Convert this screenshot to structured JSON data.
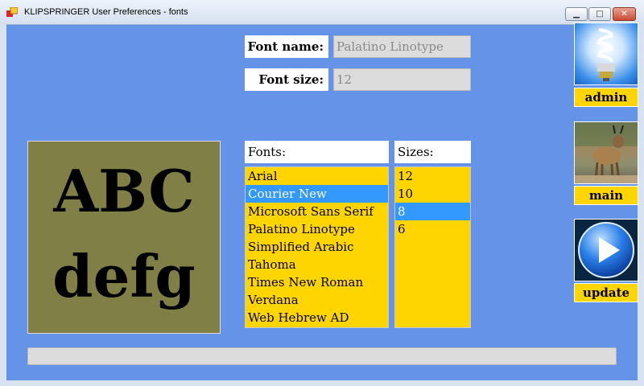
{
  "window": {
    "title": "KLIPSPRINGER User Preferences - fonts"
  },
  "font_name": {
    "label": "Font name:",
    "value": "Palatino Linotype"
  },
  "font_size": {
    "label": "Font size:",
    "value": "12"
  },
  "preview": {
    "line1": "ABC",
    "line2": "defg"
  },
  "fonts": {
    "header": "Fonts:",
    "items": [
      "Arial",
      "Courier New",
      "Microsoft Sans Serif",
      "Palatino Linotype",
      "Simplified Arabic",
      "Tahoma",
      "Times New Roman",
      "Verdana",
      "Web Hebrew AD"
    ],
    "selected": "Courier New"
  },
  "sizes": {
    "header": "Sizes:",
    "items": [
      "12",
      "10",
      "8",
      "6"
    ],
    "selected": "8"
  },
  "side_buttons": [
    {
      "label": "admin",
      "icon": "lightbulb-icon"
    },
    {
      "label": "main",
      "icon": "antelope-photo-icon"
    },
    {
      "label": "update",
      "icon": "play-icon"
    }
  ],
  "progress": {
    "fraction": 0
  },
  "colors": {
    "background": "#6593e8",
    "list_bg": "#ffd500",
    "selection": "#3399ff",
    "preview_bg": "#808046"
  }
}
